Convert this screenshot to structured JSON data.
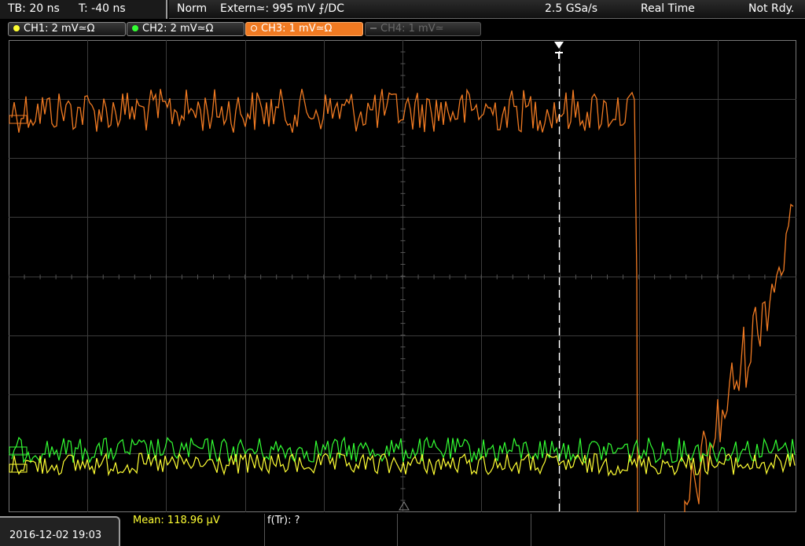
{
  "status": {
    "timebase": "TB: 20 ns",
    "trigger_offset": "T: -40 ns",
    "trigger_mode": "Norm",
    "trigger_source": "Extern≃: 995 mV ⨍/DC",
    "sample_rate": "2.5 GSa/s",
    "acq_mode": "Real Time",
    "state": "Not Rdy."
  },
  "channels": [
    {
      "label": "CH1: 2 mV≃Ω",
      "color": "#ffff33",
      "active": true
    },
    {
      "label": "CH2: 2 mV≃Ω",
      "color": "#33ff33",
      "active": true
    },
    {
      "label": "CH3: 1 mV≃Ω",
      "color": "#f07a22",
      "active": true,
      "selected": true
    },
    {
      "label": "CH4: 1 mV≃",
      "color": "#666666",
      "active": false
    }
  ],
  "measurements": {
    "mean": "Mean: 118.96 µV",
    "ftr": "f(Tr): ?"
  },
  "datetime": "2016-12-02 19:03",
  "colors": {
    "ch1": "#ffff33",
    "ch2": "#33ff33",
    "ch3": "#f07a22",
    "grid": "#3c3c3c"
  },
  "icons": {
    "trigger_marker": "trigger-T-icon",
    "ground_marker": "ground-triangle-icon"
  }
}
